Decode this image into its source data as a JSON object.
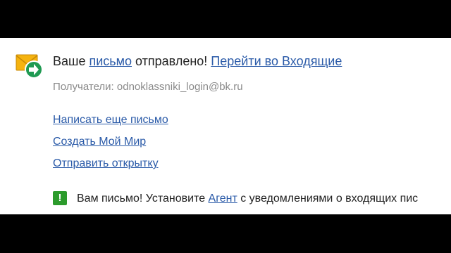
{
  "status": {
    "prefix": "Ваше ",
    "letter_link": "письмо",
    "suffix": " отправлено! ",
    "inbox_link": "Перейти во Входящие"
  },
  "recipients": {
    "label": "Получатели:",
    "address": "odnoklassniki_login@bk.ru"
  },
  "actions": [
    {
      "label": "Написать еще письмо"
    },
    {
      "label": "Создать Мой Мир"
    },
    {
      "label": "Отправить открытку"
    }
  ],
  "notice": {
    "icon": "exclamation-icon",
    "prefix": "Вам письмо! Установите ",
    "agent_link": "Агент",
    "suffix": " с уведомлениями о входящих пис"
  },
  "icons": {
    "mail": "envelope-arrow-icon"
  },
  "colors": {
    "link": "#2a5aa8",
    "text": "#222222",
    "muted": "#8a8a8a",
    "envelope": "#f5b30f",
    "arrow_badge": "#1f9a52",
    "notice_badge": "#2c9b2c"
  }
}
